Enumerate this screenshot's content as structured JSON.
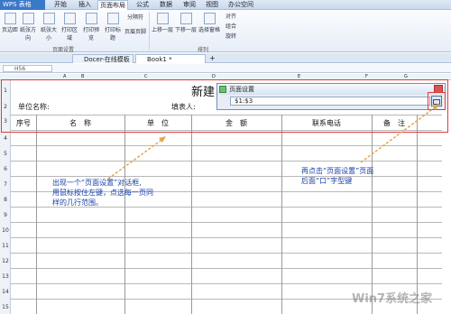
{
  "menubar": {
    "app_button": "WPS 表格",
    "tabs": [
      "开始",
      "插入",
      "页面布局",
      "公式",
      "数据",
      "审阅",
      "视图",
      "办公空间"
    ],
    "active_tab": "页面布局"
  },
  "ribbon": {
    "buttons": [
      "页边距",
      "纸张方向",
      "纸张大小",
      "打印区域",
      "打印预览",
      "打印标题",
      "页眉页脚",
      "分隔符",
      "上移一层",
      "下移一层",
      "选择窗格",
      "对齐",
      "组合",
      "旋转"
    ],
    "groups": [
      "页面设置",
      "排列"
    ]
  },
  "tabbar": {
    "tabs": [
      "Docer-在线模板",
      "Book1 *"
    ],
    "add_label": "+"
  },
  "formula_bar": {
    "name_box": "H56"
  },
  "sheet": {
    "columns": [
      "A",
      "B",
      "C",
      "D",
      "E",
      "F",
      "G"
    ],
    "rows": [
      "1",
      "2",
      "3",
      "4",
      "5",
      "6",
      "7",
      "8",
      "9",
      "10",
      "11",
      "12",
      "13",
      "14",
      "15",
      "16",
      "17"
    ],
    "title": "新建",
    "unit_label": "单位名称:",
    "filler_label": "填表人:",
    "headers": [
      "序号",
      "名　称",
      "单　位",
      "金　额",
      "联系电话",
      "备　注"
    ]
  },
  "dialog": {
    "title": "页面设置",
    "value": "$1:$3"
  },
  "annotations": {
    "left_note": [
      "出现一个“页面设置”对话框,",
      "用鼠标按住左键，点选每一页同",
      "样的几行范围。"
    ],
    "right_note": [
      "再点击“页面设置”页面",
      "后面“口”字型键"
    ],
    "color": "#e23a3a",
    "note_color": "#1a3fa8"
  },
  "watermark": "Win7系统之家"
}
